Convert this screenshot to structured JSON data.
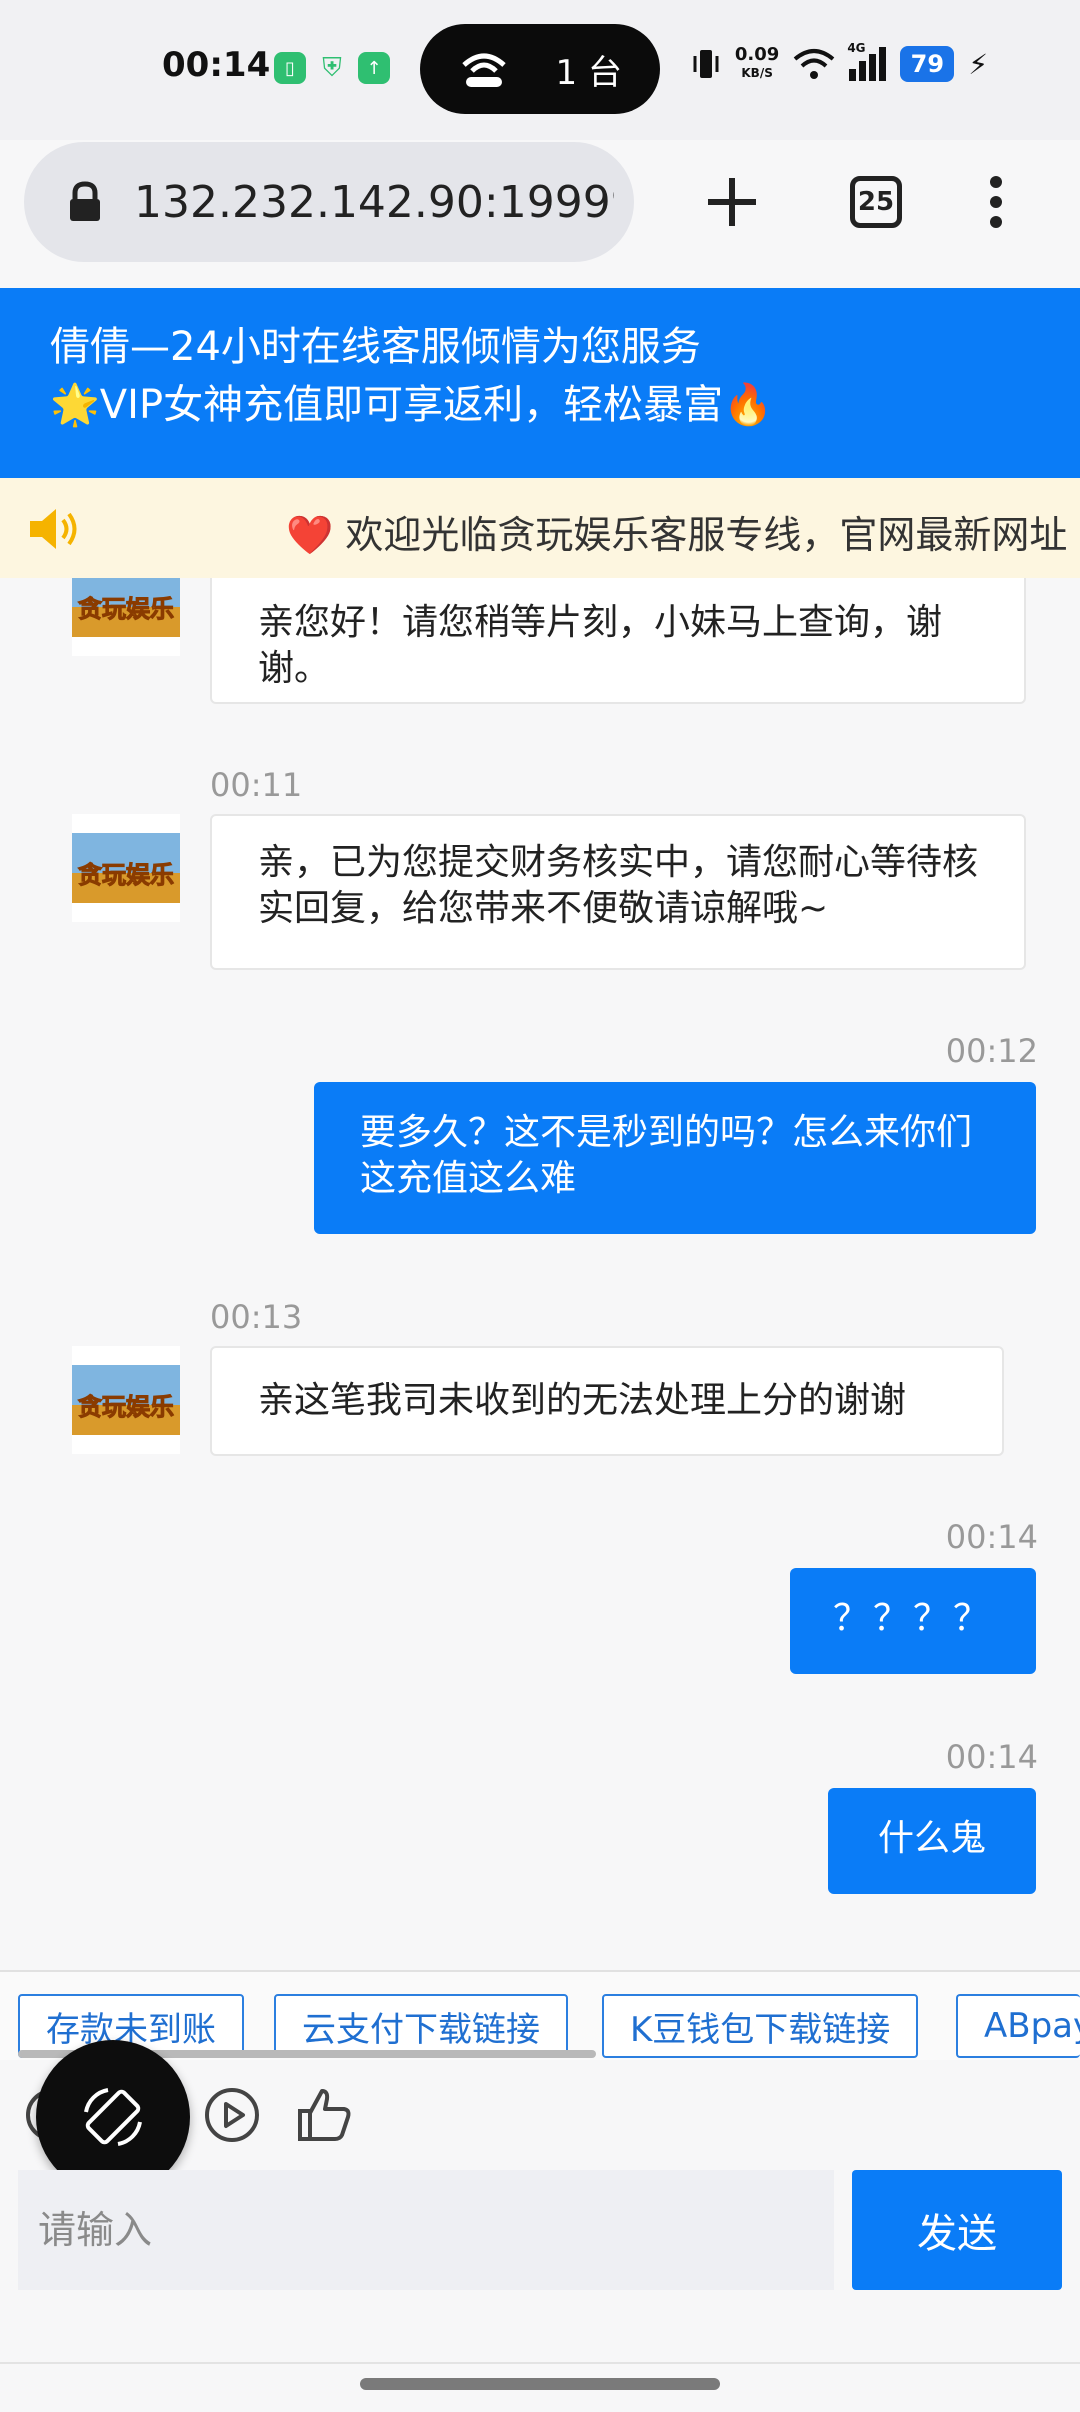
{
  "status_bar": {
    "time": "00:14",
    "pill_text": "1 台",
    "net_speed_value": "0.09",
    "net_speed_unit": "KB/S",
    "network_type": "4G",
    "battery": "79"
  },
  "browser": {
    "url": "132.232.142.90:19999/",
    "tab_count": "25"
  },
  "header": {
    "line1": "倩倩—24小时在线客服倾情为您服务",
    "line2": "🌟VIP女神充值即可享返利，轻松暴富🔥"
  },
  "notice": {
    "text": "欢迎光临贪玩娱乐客服专线，官网最新网址"
  },
  "messages": [
    {
      "side": "in",
      "time": "",
      "text": "亲您好！请您稍等片刻，小妹马上查询，谢谢。"
    },
    {
      "side": "in",
      "time": "00:11",
      "text": "亲，已为您提交财务核实中，请您耐心等待核实回复，给您带来不便敬请谅解哦~"
    },
    {
      "side": "out",
      "time": "00:12",
      "text": "要多久？这不是秒到的吗？怎么来你们这充值这么难"
    },
    {
      "side": "in",
      "time": "00:13",
      "text": "亲这笔我司未收到的无法处理上分的谢谢"
    },
    {
      "side": "out",
      "time": "00:14",
      "text": "？？？？"
    },
    {
      "side": "out",
      "time": "00:14",
      "text": "什么鬼"
    }
  ],
  "avatar_logo_text": "贪玩娱乐",
  "quick_replies": [
    "存款未到账",
    "云支付下载链接",
    "K豆钱包下载链接",
    "ABpay"
  ],
  "input": {
    "placeholder": "请输入",
    "send_label": "发送"
  },
  "colors": {
    "primary": "#0a7cf7",
    "notice_bg": "#fdf6e0",
    "heart": "#e03131"
  }
}
